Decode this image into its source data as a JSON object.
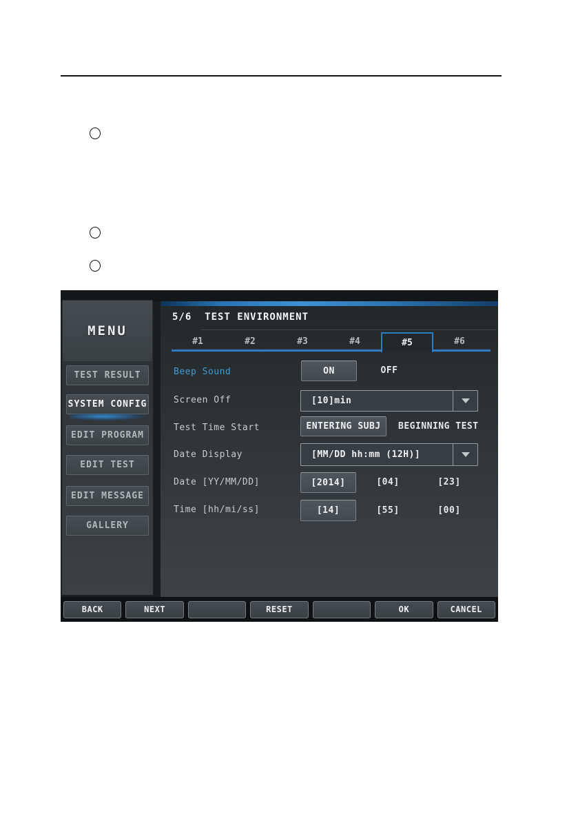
{
  "screen": {
    "menu": {
      "title": "MENU",
      "items": [
        {
          "label": "TEST RESULT",
          "active": false
        },
        {
          "label": "SYSTEM CONFIG",
          "active": true
        },
        {
          "label": "EDIT PROGRAM",
          "active": false
        },
        {
          "label": "EDIT TEST",
          "active": false
        },
        {
          "label": "EDIT MESSAGE",
          "active": false
        },
        {
          "label": "GALLERY",
          "active": false
        }
      ]
    },
    "header": {
      "page_indicator": "5/6",
      "title": "TEST ENVIRONMENT",
      "combined": "5/6  TEST ENVIRONMENT"
    },
    "tabs": [
      "#1",
      "#2",
      "#3",
      "#4",
      "#5",
      "#6"
    ],
    "active_tab": "#5",
    "rows": {
      "beep": {
        "label": "Beep Sound",
        "selected": "ON",
        "unselected": "OFF"
      },
      "screen_off": {
        "label": "Screen Off",
        "value": "[10]min"
      },
      "test_time": {
        "label": "Test Time Start",
        "selected": "ENTERING SUBJ",
        "unselected": "BEGINNING TEST"
      },
      "date_display": {
        "label": "Date Display",
        "value": "[MM/DD hh:mm (12H)]"
      },
      "date": {
        "label": "Date [YY/MM/DD]",
        "year": "[2014]",
        "month": "[04]",
        "day": "[23]"
      },
      "time": {
        "label": "Time [hh/mi/ss]",
        "hour": "[14]",
        "minute": "[55]",
        "second": "[00]"
      }
    },
    "footer": {
      "buttons": [
        "BACK",
        "NEXT",
        "",
        "RESET",
        "",
        "OK",
        "CANCEL"
      ]
    },
    "colors": {
      "accent_blue": "#2e7cc3",
      "highlight_label_blue": "#3f9bd4",
      "panel_dark": "#23272b",
      "button_gray": "#454c51"
    }
  }
}
